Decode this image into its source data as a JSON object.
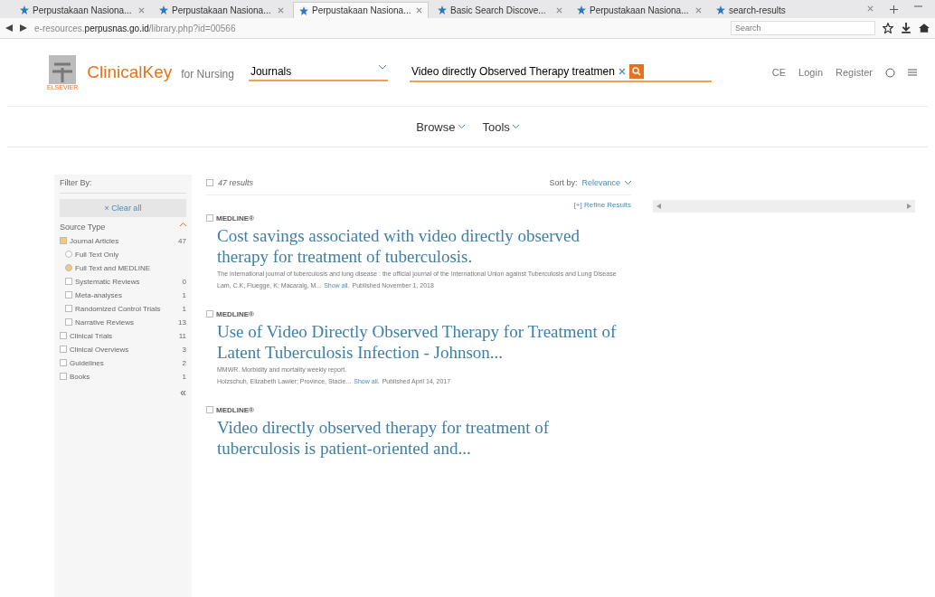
{
  "browser": {
    "tabs": [
      {
        "title": "Perpustakaan Nasiona...",
        "selected": false,
        "closable": true
      },
      {
        "title": "Perpustakaan Nasiona...",
        "selected": false,
        "closable": true
      },
      {
        "title": "Perpustakaan Nasiona...",
        "selected": true,
        "closable": true
      },
      {
        "title": "Basic Search Discove...",
        "selected": false,
        "closable": true
      },
      {
        "title": "Perpustakaan Nasiona...",
        "selected": false,
        "closable": true
      },
      {
        "title": "search-results",
        "selected": false,
        "closable": false
      }
    ],
    "address": {
      "prefix": "e-resources.",
      "domain": "perpusnas.go.id",
      "path": "/library.php?id=00566"
    },
    "search": {
      "placeholder": "Search"
    }
  },
  "header": {
    "logo_caption": "ELSEVIER",
    "brand": "ClinicalKey",
    "brand_suffix": "for Nursing",
    "scope": "Journals",
    "query": "Video directly Observed Therapy treatmen",
    "links": [
      "CE",
      "Login",
      "Register"
    ]
  },
  "nav": [
    "Browse",
    "Tools"
  ],
  "sidebar": {
    "title": "Filter By:",
    "clear": "× Clear all",
    "section": "Source Type",
    "expanded": true,
    "collapse": "«",
    "filters": [
      {
        "kind": "checkbox",
        "label": "Journal Articles",
        "count": "47",
        "checked": true,
        "children": [
          {
            "kind": "radio",
            "label": "Full Text Only",
            "selected": false
          },
          {
            "kind": "radio",
            "label": "Full Text and MEDLINE",
            "selected": true
          },
          {
            "kind": "checkbox",
            "label": "Systematic Reviews",
            "count": "0",
            "checked": false
          },
          {
            "kind": "checkbox",
            "label": "Meta-analyses",
            "count": "1",
            "checked": false
          },
          {
            "kind": "checkbox",
            "label": "Randomized Control Trials",
            "count": "1",
            "checked": false
          },
          {
            "kind": "checkbox",
            "label": "Narrative Reviews",
            "count": "13",
            "checked": false
          }
        ]
      },
      {
        "kind": "checkbox",
        "label": "Clinical Trials",
        "count": "11",
        "checked": false
      },
      {
        "kind": "checkbox",
        "label": "Clinical Overviews",
        "count": "3",
        "checked": false
      },
      {
        "kind": "checkbox",
        "label": "Guidelines",
        "count": "2",
        "checked": false
      },
      {
        "kind": "checkbox",
        "label": "Books",
        "count": "1",
        "checked": false
      }
    ]
  },
  "results": {
    "count": "47 results",
    "all_checked": false,
    "sort_label": "Sort by:",
    "sort": "Relevance",
    "refine": "[+] Refine Results",
    "items": [
      {
        "source": "MEDLINE®",
        "checked": false,
        "title": "Cost savings associated with video directly observed therapy for treatment of tuberculosis.",
        "journal": "The international journal of tuberculosis and lung disease : the official journal of the International Union against Tuberculosis and Lung Disease",
        "authors": "Lam, C.K; Fluegge, K; Macaraig, M...",
        "show_all": "Show all.",
        "published": "Published November 1, 2018"
      },
      {
        "source": "MEDLINE®",
        "checked": false,
        "title": "Use of Video Directly Observed Therapy for Treatment of Latent Tuberculosis Infection - Johnson...",
        "journal": "MMWR. Morbidity and mortality weekly report.",
        "authors": "Holzschuh, Elizabeth Lawler; Province, Stacie...",
        "show_all": "Show all.",
        "published": "Published April 14, 2017"
      },
      {
        "source": "MEDLINE®",
        "checked": false,
        "title": "Video directly observed therapy for treatment of tuberculosis is patient-oriented and..."
      }
    ]
  }
}
